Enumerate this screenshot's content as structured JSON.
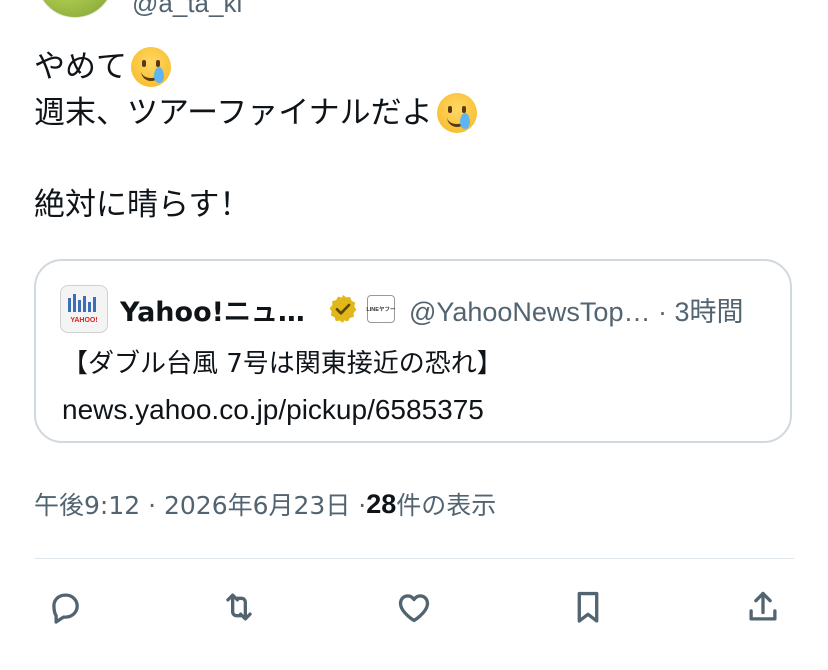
{
  "author": {
    "handle": "@a_ta_ki"
  },
  "tweet": {
    "lines": [
      "やめて",
      "週末、ツアーファイナルだよ",
      "絶対に晴らす！"
    ]
  },
  "quote": {
    "name": "Yahoo!ニュ…",
    "affiliate_label": "LINEヤフー",
    "handle_time": "@YahooNewsTop… · 3時間",
    "avatar_label": "YAHOO!",
    "headline": "【ダブル台風 7号は関東接近の恐れ】",
    "url": "news.yahoo.co.jp/pickup/6585375"
  },
  "meta": {
    "timestamp": "午後9:12 · 2026年6月23日 · ",
    "views_count": "28",
    "views_label": " 件の表示"
  },
  "icons": {
    "emoji": "face-holding-back-tears",
    "verified": "gold-verified-badge",
    "actions": [
      "reply-icon",
      "retweet-icon",
      "like-icon",
      "bookmark-icon",
      "share-icon"
    ]
  },
  "colors": {
    "text": "#0f1419",
    "muted": "#536471",
    "border": "#cfd9de",
    "verified_gold": "#e2b719"
  }
}
